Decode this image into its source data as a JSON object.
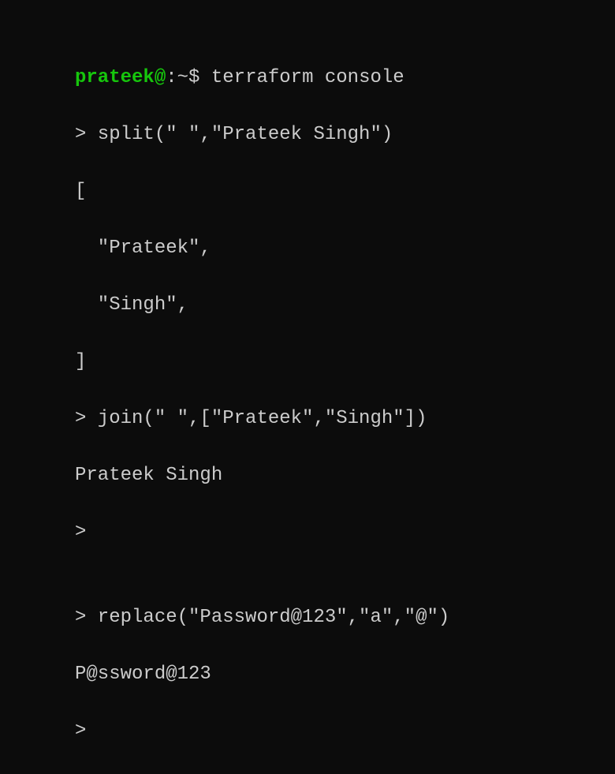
{
  "prompt": {
    "user": "prateek",
    "at": "@",
    "colon": ":",
    "tilde": "~",
    "dollar": "$"
  },
  "lines": {
    "command1": " terraform console",
    "line2": "> split(\" \",\"Prateek Singh\")",
    "line3": "[",
    "line4": "  \"Prateek\",",
    "line5": "  \"Singh\",",
    "line6": "]",
    "line7": "> join(\" \",[\"Prateek\",\"Singh\"])",
    "line8": "Prateek Singh",
    "line9": ">",
    "line10": "",
    "line11": "> replace(\"Password@123\",\"a\",\"@\")",
    "line12": "P@ssword@123",
    "line13": ">"
  }
}
